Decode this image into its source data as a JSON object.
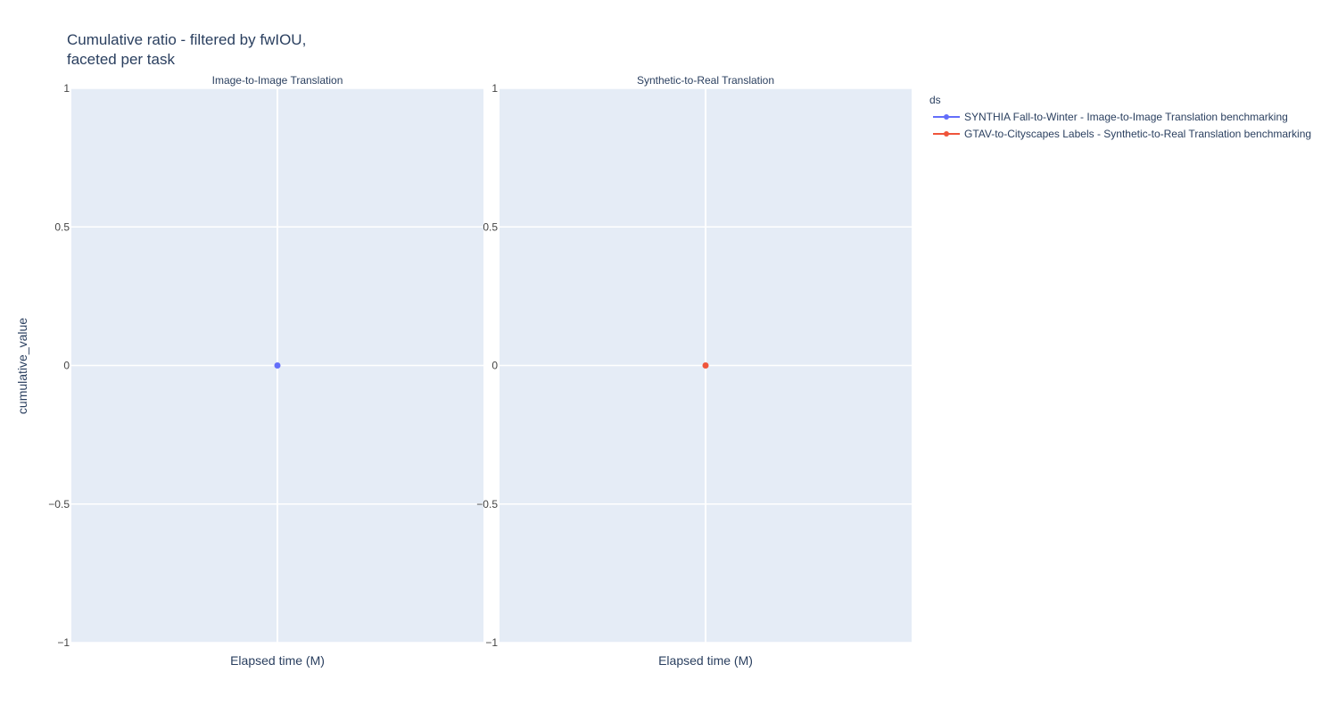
{
  "figure": {
    "title_line1": "Cumulative ratio - filtered by fwIOU,",
    "title_line2": "faceted per task"
  },
  "chart_data": {
    "type": "scatter",
    "ylabel": "cumulative_value",
    "ylim": [
      -1,
      1
    ],
    "yticks": [
      1,
      0.5,
      0,
      -0.5,
      -1
    ],
    "ytick_labels": [
      "1",
      "0.5",
      "0",
      "−0.5",
      "−1"
    ],
    "grid": true,
    "legend_title": "ds",
    "legend_position": "right",
    "panels": [
      {
        "subplot_title": "Image-to-Image Translation",
        "xlabel": "Elapsed time (M)",
        "series": [
          {
            "name": "SYNTHIA Fall-to-Winter - Image-to-Image Translation benchmarking",
            "color": "#636efa",
            "points": [
              {
                "x": 0,
                "y": 0
              }
            ]
          }
        ]
      },
      {
        "subplot_title": "Synthetic-to-Real Translation",
        "xlabel": "Elapsed time (M)",
        "series": [
          {
            "name": "GTAV-to-Cityscapes Labels - Synthetic-to-Real Translation benchmarking",
            "color": "#ef553b",
            "points": [
              {
                "x": 0,
                "y": 0
              }
            ]
          }
        ]
      }
    ],
    "legend": [
      {
        "name": "SYNTHIA Fall-to-Winter - Image-to-Image Translation benchmarking",
        "color": "#636efa"
      },
      {
        "name": "GTAV-to-Cityscapes Labels - Synthetic-to-Real Translation benchmarking",
        "color": "#ef553b"
      }
    ]
  }
}
